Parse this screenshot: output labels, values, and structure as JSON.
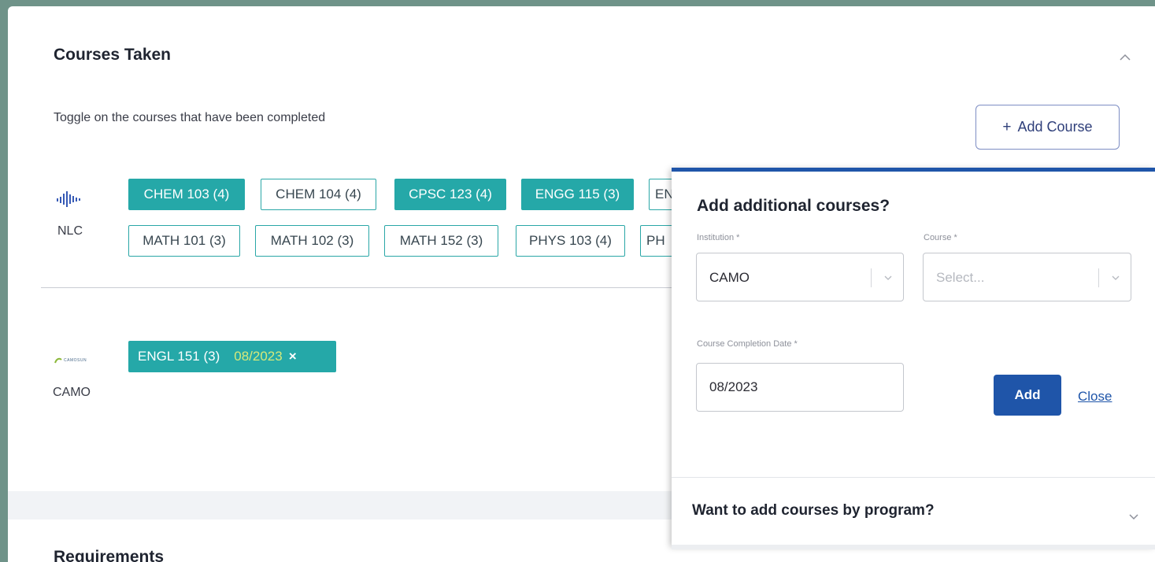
{
  "card": {
    "title": "Courses Taken",
    "subtitle": "Toggle on the courses that have been completed",
    "add_course_label": "Add Course",
    "add_course_icon": "plus-icon"
  },
  "institutions": [
    {
      "name": "NLC",
      "logo": "nlc-logo",
      "courses": [
        {
          "label": "CHEM 103 (4)",
          "completed": true
        },
        {
          "label": "CHEM 104 (4)",
          "completed": false
        },
        {
          "label": "CPSC 123 (4)",
          "completed": true
        },
        {
          "label": "ENGG 115 (3)",
          "completed": true
        },
        {
          "label": "EN",
          "completed": false
        },
        {
          "label": "MATH 101 (3)",
          "completed": false
        },
        {
          "label": "MATH 102 (3)",
          "completed": false
        },
        {
          "label": "MATH 152 (3)",
          "completed": false
        },
        {
          "label": "PHYS 103 (4)",
          "completed": false
        },
        {
          "label": "PH",
          "completed": false
        }
      ]
    },
    {
      "name": "CAMO",
      "logo": "camo-logo",
      "logo_text": "CAMOSUN",
      "courses": [
        {
          "label": "ENGL 151 (3)",
          "date": "08/2023",
          "remove_icon": "×",
          "completed": true
        }
      ]
    }
  ],
  "popover": {
    "title": "Add additional courses?",
    "institution_label": "Institution *",
    "institution_value": "CAMO",
    "course_label": "Course *",
    "course_placeholder": "Select...",
    "date_label": "Course Completion Date *",
    "date_value": "08/2023",
    "add_label": "Add",
    "close_label": "Close",
    "program_title": "Want to add courses by program?"
  },
  "next_section_title": "Requirements",
  "colors": {
    "accent_teal": "#25a8a8",
    "primary_blue": "#1f55a9",
    "date_yellow": "#d6e97a",
    "frame_bg": "#6f9389"
  }
}
